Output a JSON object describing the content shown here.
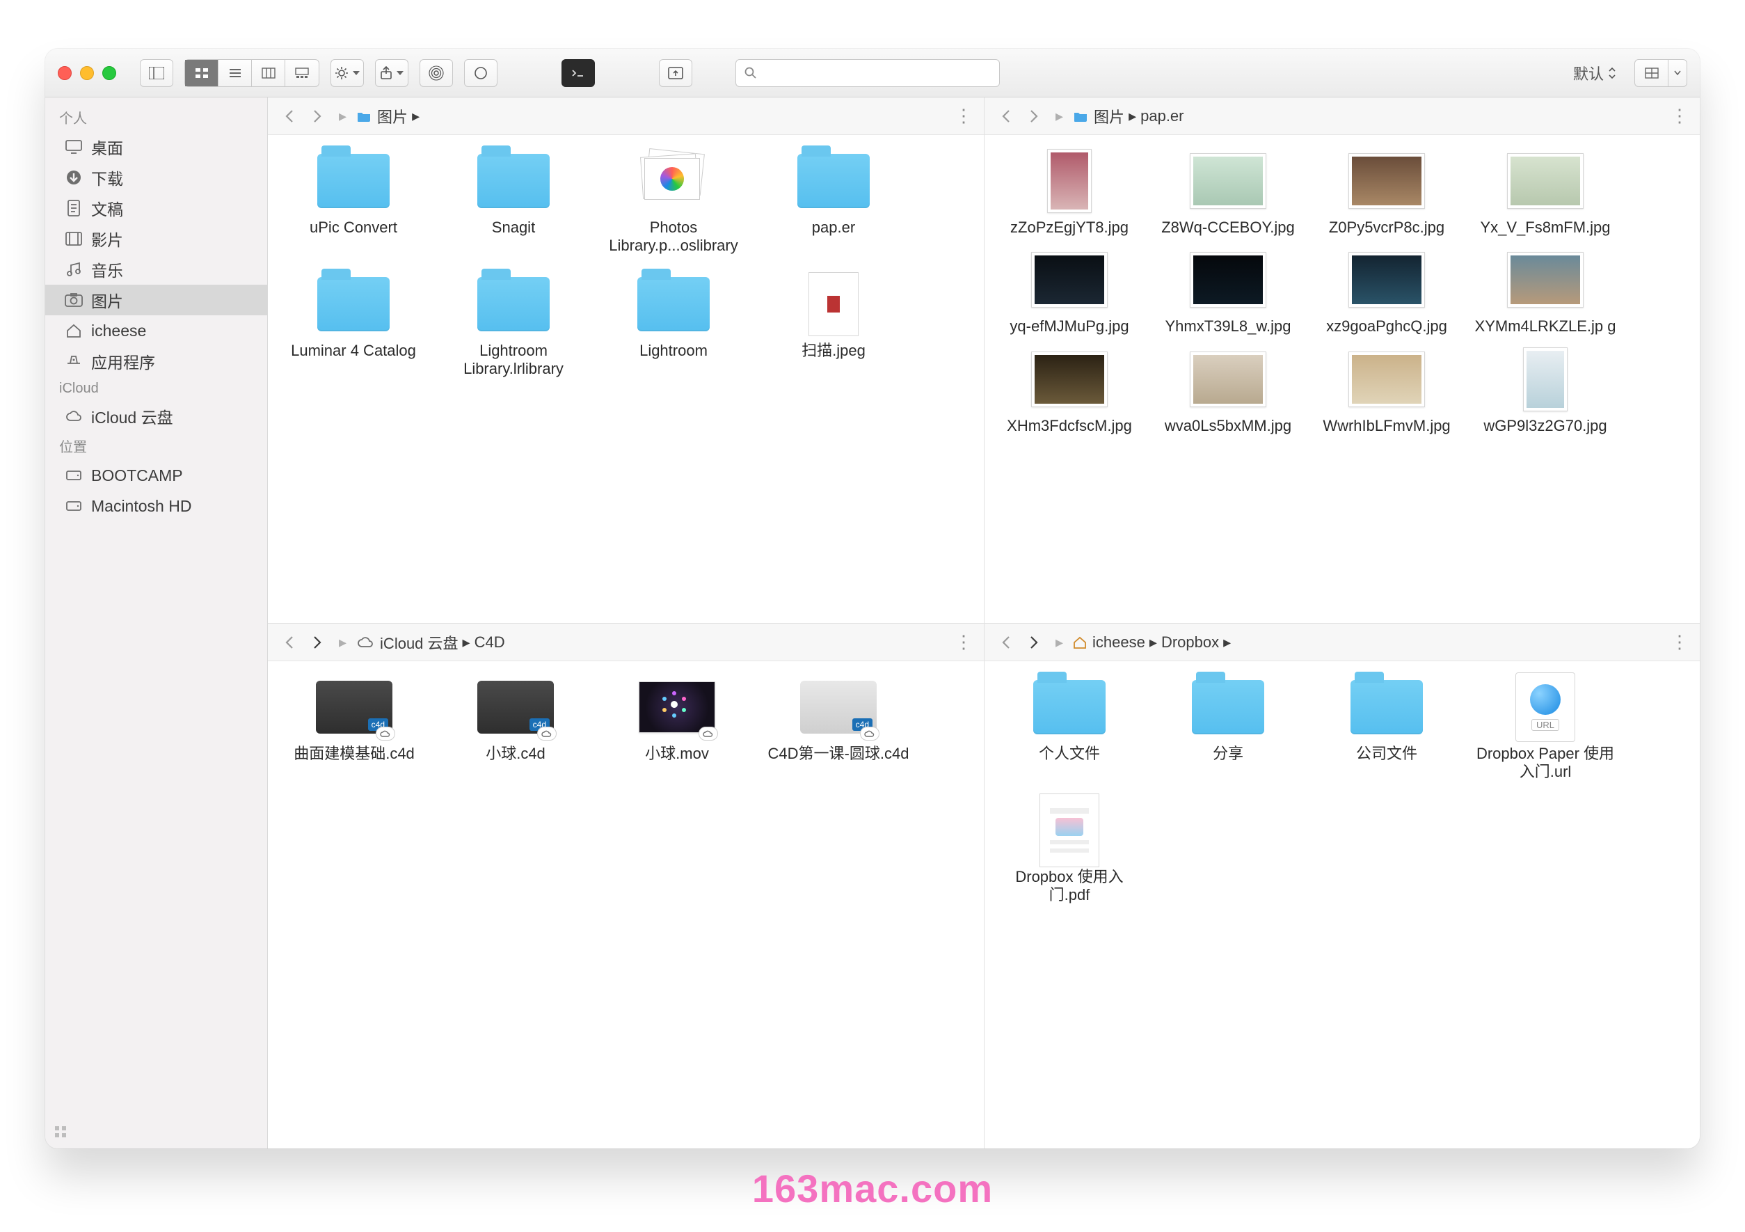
{
  "toolbar": {
    "sort_label": "默认",
    "search_placeholder": ""
  },
  "sidebar": {
    "sections": [
      {
        "title": "个人",
        "items": [
          {
            "label": "桌面",
            "icon": "desktop"
          },
          {
            "label": "下载",
            "icon": "download"
          },
          {
            "label": "文稿",
            "icon": "doc"
          },
          {
            "label": "影片",
            "icon": "film"
          },
          {
            "label": "音乐",
            "icon": "music"
          },
          {
            "label": "图片",
            "icon": "photo",
            "active": true
          },
          {
            "label": "icheese",
            "icon": "home"
          },
          {
            "label": "应用程序",
            "icon": "apps"
          }
        ]
      },
      {
        "title": "iCloud",
        "items": [
          {
            "label": "iCloud 云盘",
            "icon": "cloud"
          }
        ]
      },
      {
        "title": "位置",
        "items": [
          {
            "label": "BOOTCAMP",
            "icon": "disk"
          },
          {
            "label": "Macintosh HD",
            "icon": "disk"
          }
        ]
      }
    ]
  },
  "panes": [
    {
      "crumbs": [
        {
          "icon": "folder-blue",
          "label": "图片"
        }
      ],
      "trailing_sep": true,
      "items": [
        {
          "type": "folder",
          "label": "uPic Convert"
        },
        {
          "type": "folder",
          "label": "Snagit"
        },
        {
          "type": "photoslib",
          "label": "Photos Library.p...oslibrary"
        },
        {
          "type": "folder",
          "label": "pap.er"
        },
        {
          "type": "folder",
          "label": "Luminar 4 Catalog"
        },
        {
          "type": "folder",
          "label": "Lightroom Library.lrlibrary"
        },
        {
          "type": "folder",
          "label": "Lightroom"
        },
        {
          "type": "doc",
          "label": "扫描.jpeg",
          "accent": "#b33"
        }
      ]
    },
    {
      "crumbs": [
        {
          "icon": "folder-blue",
          "label": "图片"
        },
        {
          "label": "pap.er"
        }
      ],
      "items": [
        {
          "type": "img",
          "label": "zZoPzEgjYT8.jpg",
          "bg": "linear-gradient(#b05a6a,#d9b5b6)",
          "portrait": true
        },
        {
          "type": "img",
          "label": "Z8Wq-CCEBOY.jpg",
          "bg": "linear-gradient(#cfe5d5,#a9c8b3)"
        },
        {
          "type": "img",
          "label": "Z0Py5vcrP8c.jpg",
          "bg": "linear-gradient(#6a4d3a,#a98866)"
        },
        {
          "type": "img",
          "label": "Yx_V_Fs8mFM.jpg",
          "bg": "linear-gradient(#d7e3cf,#b7c8ae)"
        },
        {
          "type": "img",
          "label": "yq-efMJMuPg.jpg",
          "bg": "linear-gradient(#0a0f14,#1b2733)"
        },
        {
          "type": "img",
          "label": "YhmxT39L8_w.jpg",
          "bg": "linear-gradient(#05080c,#0d1a24)"
        },
        {
          "type": "img",
          "label": "xz9goaPghcQ.jpg",
          "bg": "linear-gradient(#132431,#2a5368)"
        },
        {
          "type": "img",
          "label": "XYMm4LRKZLE.jp g",
          "bg": "linear-gradient(#6a8a9a,#b79a7a)"
        },
        {
          "type": "img",
          "label": "XHm3FdcfscM.jpg",
          "bg": "linear-gradient(#2b2214,#6b5a3a)"
        },
        {
          "type": "img",
          "label": "wva0Ls5bxMM.jpg",
          "bg": "linear-gradient(#dacfbf,#b8a98f)"
        },
        {
          "type": "img",
          "label": "WwrhIbLFmvM.jpg",
          "bg": "linear-gradient(#cbb28a,#e0d4b8)"
        },
        {
          "type": "img",
          "label": "wGP9l3z2G70.jpg",
          "bg": "linear-gradient(#e8eef2,#b8d1da)",
          "portrait": true
        }
      ]
    },
    {
      "crumbs": [
        {
          "icon": "cloud",
          "label": "iCloud 云盘"
        },
        {
          "label": "C4D"
        }
      ],
      "items": [
        {
          "type": "c4d",
          "label": "曲面建模基础.c4d",
          "cloud": true
        },
        {
          "type": "c4d",
          "label": "小球.c4d",
          "cloud": true
        },
        {
          "type": "mov",
          "label": "小球.mov",
          "cloud": true
        },
        {
          "type": "c4d",
          "label": "C4D第一课-圆球.c4d",
          "cloud": true,
          "light": true
        }
      ]
    },
    {
      "crumbs": [
        {
          "icon": "home",
          "label": "icheese"
        },
        {
          "label": "Dropbox"
        }
      ],
      "trailing_sep": true,
      "items": [
        {
          "type": "folder",
          "label": "个人文件"
        },
        {
          "type": "folder",
          "label": "分享"
        },
        {
          "type": "folder",
          "label": "公司文件"
        },
        {
          "type": "url",
          "label": "Dropbox Paper 使用入门.url"
        },
        {
          "type": "pdf",
          "label": "Dropbox 使用入门.pdf"
        }
      ]
    }
  ],
  "watermark": "163mac.com"
}
